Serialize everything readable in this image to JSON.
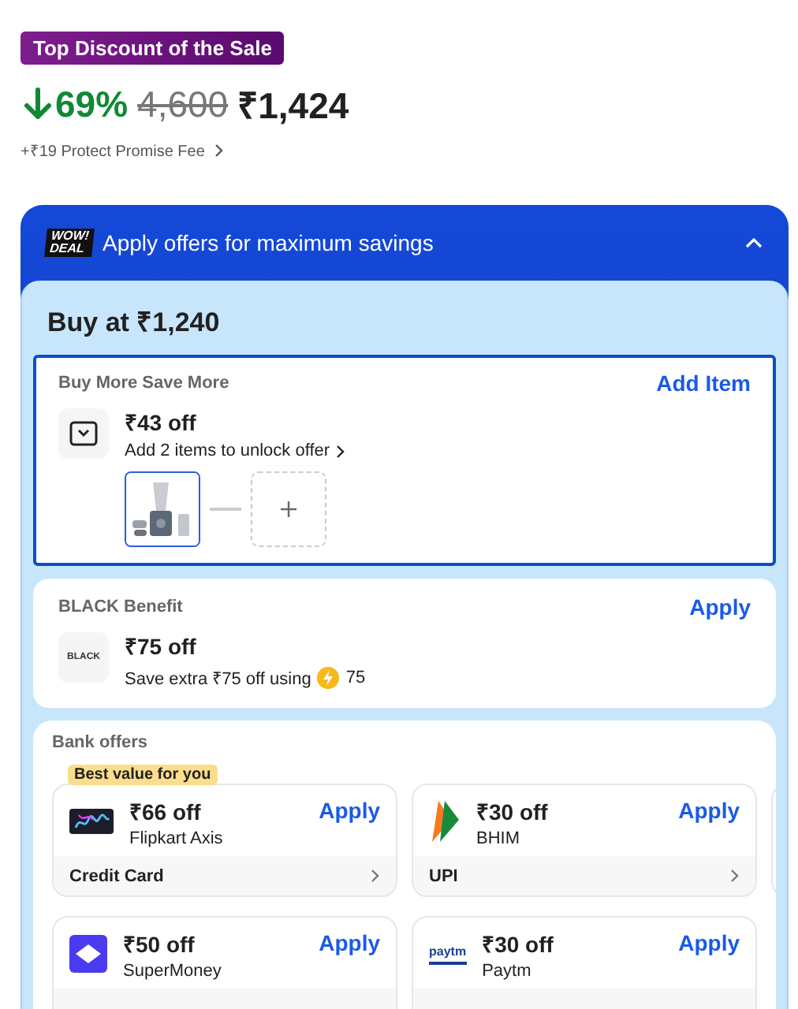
{
  "badge": "Top Discount of the Sale",
  "price": {
    "discount": "69%",
    "mrp": "4,600",
    "final": "₹1,424",
    "fee": "+₹19 Protect Promise Fee"
  },
  "offers": {
    "logo": [
      "WOW!",
      "DEAL"
    ],
    "title": "Apply offers for maximum savings",
    "expanded": true,
    "buy_at": "Buy at ₹1,240",
    "sections": [
      {
        "kind": "bundle",
        "heading": "Buy More Save More",
        "action": "Add Item",
        "selected": true,
        "amount": "₹43 off",
        "note": "Add 2 items to unlock offer"
      },
      {
        "kind": "benefit",
        "heading": "BLACK Benefit",
        "action": "Apply",
        "selected": false,
        "logo": "BLACK",
        "amount": "₹75 off",
        "note": "Save extra ₹75 off using",
        "coins": "75"
      },
      {
        "kind": "bank",
        "heading": "Bank offers",
        "tag": "Best value for you",
        "rows": [
          {
            "more": true,
            "cards": [
              {
                "kind": "card",
                "amount": "₹66 off",
                "name": "Flipkart Axis",
                "action": "Apply",
                "footer": "Credit Card"
              },
              {
                "kind": "bhim",
                "amount": "₹30 off",
                "name": "BHIM",
                "action": "Apply",
                "footer": "UPI"
              }
            ]
          },
          {
            "more": false,
            "cards": [
              {
                "kind": "supermoney",
                "amount": "₹50 off",
                "name": "SuperMoney",
                "action": "Apply"
              },
              {
                "kind": "paytm",
                "logo_text": "paytm",
                "amount": "₹30 off",
                "name": "Paytm",
                "action": "Apply"
              }
            ]
          }
        ]
      }
    ]
  }
}
